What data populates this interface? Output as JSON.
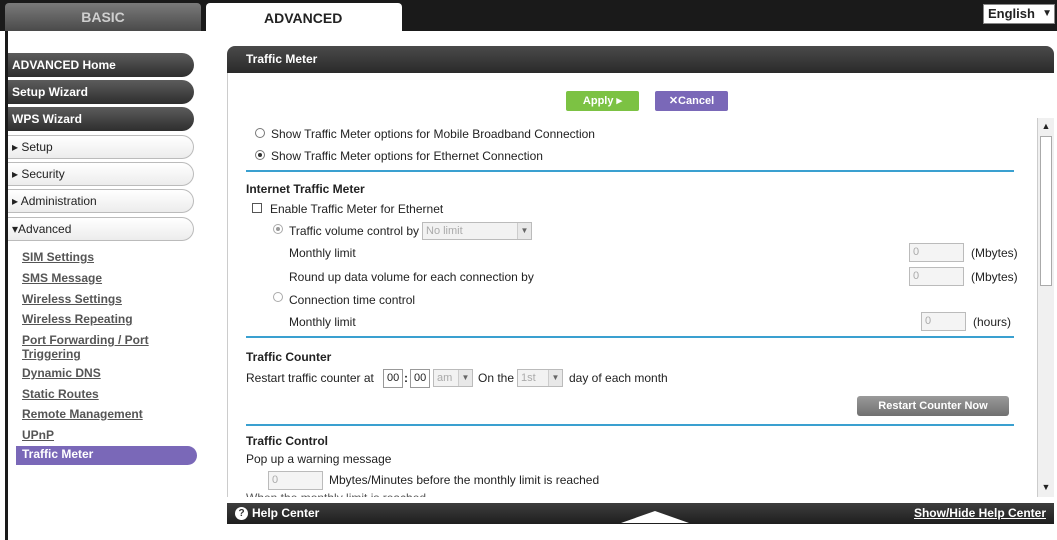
{
  "tabs": {
    "basic": "BASIC",
    "advanced": "ADVANCED"
  },
  "language": {
    "value": "English",
    "arrow": "▼"
  },
  "nav": {
    "main": [
      "ADVANCED Home",
      "Setup Wizard",
      "WPS Wizard"
    ],
    "sections": [
      "▸ Setup",
      "▸ Security",
      "▸ Administration",
      "▾Advanced"
    ],
    "subitems": [
      "SIM Settings",
      "SMS Message",
      "Wireless Settings",
      "Wireless Repeating",
      "Port Forwarding / Port",
      "Triggering",
      "Dynamic DNS",
      "Static Routes",
      "Remote Management",
      "UPnP"
    ],
    "active": "Traffic Meter"
  },
  "panel": {
    "title": "Traffic Meter",
    "apply": "Apply ▸",
    "cancel": "✕Cancel",
    "radio_mobile": "Show Traffic Meter options for Mobile Broadband Connection",
    "radio_ethernet": "Show Traffic Meter options for Ethernet Connection",
    "internet_heading": "Internet Traffic Meter",
    "enable_label": "Enable Traffic Meter for Ethernet",
    "volume_control": "Traffic volume control by",
    "volume_select": "No limit",
    "monthly_limit": "Monthly limit",
    "monthly_value": "0",
    "mbytes": "(Mbytes)",
    "roundup": "Round up data volume for each connection by",
    "roundup_value": "0",
    "connection_time": "Connection time control",
    "monthly_limit2": "Monthly limit",
    "hours_value": "0",
    "hours": "(hours)",
    "counter_heading": "Traffic Counter",
    "restart_at": "Restart traffic counter at",
    "hh": "00",
    "colon": ":",
    "mm": "00",
    "ampm": "am",
    "on_the": "On the",
    "day": "1st",
    "day_suffix": "day of each month",
    "restart_btn": "Restart Counter Now",
    "control_heading": "Traffic Control",
    "popup": "Pop up a warning message",
    "warn_value": "0",
    "warn_suffix": "Mbytes/Minutes before the monthly limit is reached",
    "cut_text": "When the monthly limit is reached"
  },
  "footer": {
    "help_icon": "?",
    "help": "Help Center",
    "show_hide": "Show/Hide Help Center"
  },
  "colors": {
    "accent_purple": "#7a68b8",
    "apply_green": "#7cc243",
    "separator_blue": "#3aa0d0"
  }
}
